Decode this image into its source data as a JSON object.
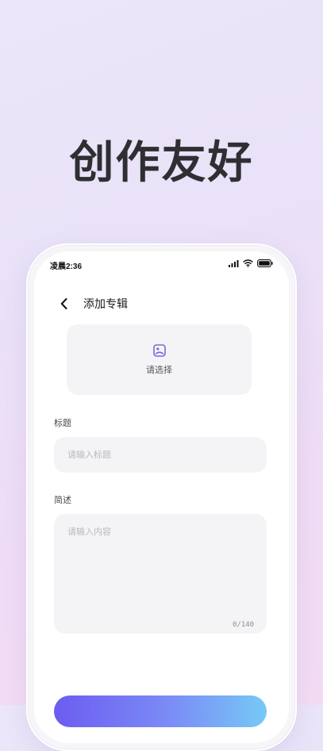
{
  "promo": {
    "headline": "创作友好"
  },
  "status_bar": {
    "time": "凌晨2:36"
  },
  "nav": {
    "title": "添加专辑"
  },
  "cover": {
    "label": "请选择"
  },
  "form": {
    "title_label": "标题",
    "title_placeholder": "请输入标题",
    "desc_label": "简述",
    "desc_placeholder": "请输入内容",
    "char_counter": "0/140"
  },
  "colors": {
    "accent_start": "#6c5cf1",
    "accent_end": "#76c9f6",
    "icon_accent": "#7b6ad6"
  }
}
